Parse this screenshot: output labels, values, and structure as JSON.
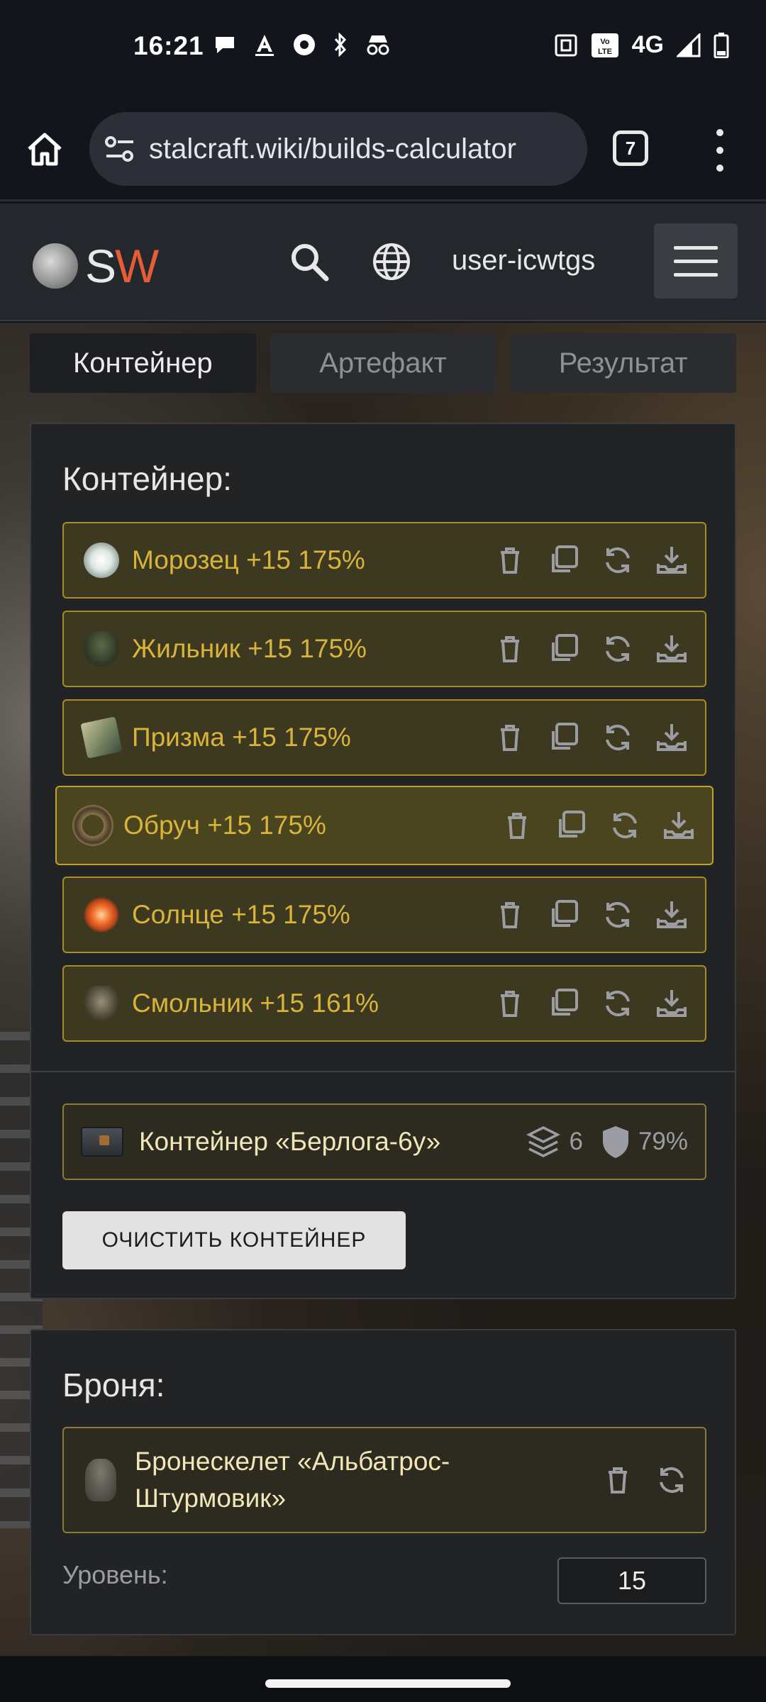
{
  "status_bar": {
    "time": "16:21",
    "network": "4G",
    "volte": "Vo LTE",
    "icons": [
      "chat-bubble-icon",
      "text-a-icon",
      "record-icon",
      "bluetooth-icon",
      "incognito-icon",
      "nfc-icon",
      "volte-icon",
      "signal-icon",
      "battery-icon"
    ]
  },
  "browser": {
    "url": "stalcraft.wiki/builds-calculator",
    "tab_count": "7"
  },
  "site_header": {
    "logo_s": "S",
    "logo_w": "W",
    "username": "user-icwtgs"
  },
  "tabs": [
    {
      "label": "Контейнер",
      "active": true
    },
    {
      "label": "Артефакт",
      "active": false
    },
    {
      "label": "Результат",
      "active": false
    }
  ],
  "container_panel": {
    "title": "Контейнер:",
    "artifacts": [
      {
        "label": "Морозец +15 175%",
        "icon": "frost-artifact-icon",
        "color": "#e6eeea"
      },
      {
        "label": "Жильник +15 175%",
        "icon": "vein-artifact-icon",
        "color": "#3f4a32"
      },
      {
        "label": "Призма +15 175%",
        "icon": "prism-artifact-icon",
        "color": "#9fa076"
      },
      {
        "label": "Обруч +15 175%",
        "icon": "hoop-artifact-icon",
        "color": "#6d5a40"
      },
      {
        "label": "Солнце +15 175%",
        "icon": "sun-artifact-icon",
        "color": "#f0702c"
      },
      {
        "label": "Смольник +15 161%",
        "icon": "resin-artifact-icon",
        "color": "#6a6350"
      }
    ],
    "container": {
      "label": "Контейнер «Берлога-6у»",
      "slots": "6",
      "protection": "79%"
    },
    "clear_button": "ОЧИСТИТЬ КОНТЕЙНЕР"
  },
  "armor_panel": {
    "title": "Броня:",
    "armor_label": "Бронескелет «Альбатрос-Штурмовик»",
    "level_label": "Уровень:",
    "level_value": "15"
  },
  "colors": {
    "accent_gold": "#d8b43a",
    "row_border": "#a88c2a",
    "logo_w": "#e55d37"
  }
}
